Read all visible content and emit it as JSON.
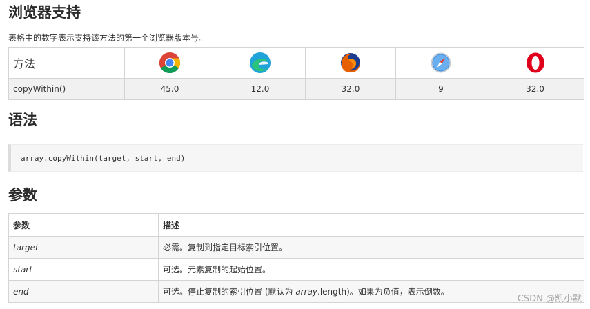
{
  "browser_section": {
    "title": "浏览器支持",
    "intro": "表格中的数字表示支持该方法的第一个浏览器版本号。",
    "method_header": "方法",
    "browsers": [
      {
        "icon": "chrome-icon"
      },
      {
        "icon": "edge-icon"
      },
      {
        "icon": "firefox-icon"
      },
      {
        "icon": "safari-icon"
      },
      {
        "icon": "opera-icon"
      }
    ],
    "row": {
      "method": "copyWithin()",
      "versions": [
        "45.0",
        "12.0",
        "32.0",
        "9",
        "32.0"
      ]
    }
  },
  "syntax_section": {
    "title": "语法",
    "code": "array.copyWithin(target, start, end)"
  },
  "params_section": {
    "title": "参数",
    "headers": [
      "参数",
      "描述"
    ],
    "rows": [
      {
        "name": "target",
        "desc": "必需。复制到指定目标索引位置。"
      },
      {
        "name": "start",
        "desc": "可选。元素复制的起始位置。"
      },
      {
        "name": "end",
        "desc_before": "可选。停止复制的索引位置 (默认为 ",
        "desc_em": "array",
        "desc_after": ".length)。如果为负值，表示倒数。"
      }
    ]
  },
  "watermark": "CSDN @凯小默"
}
